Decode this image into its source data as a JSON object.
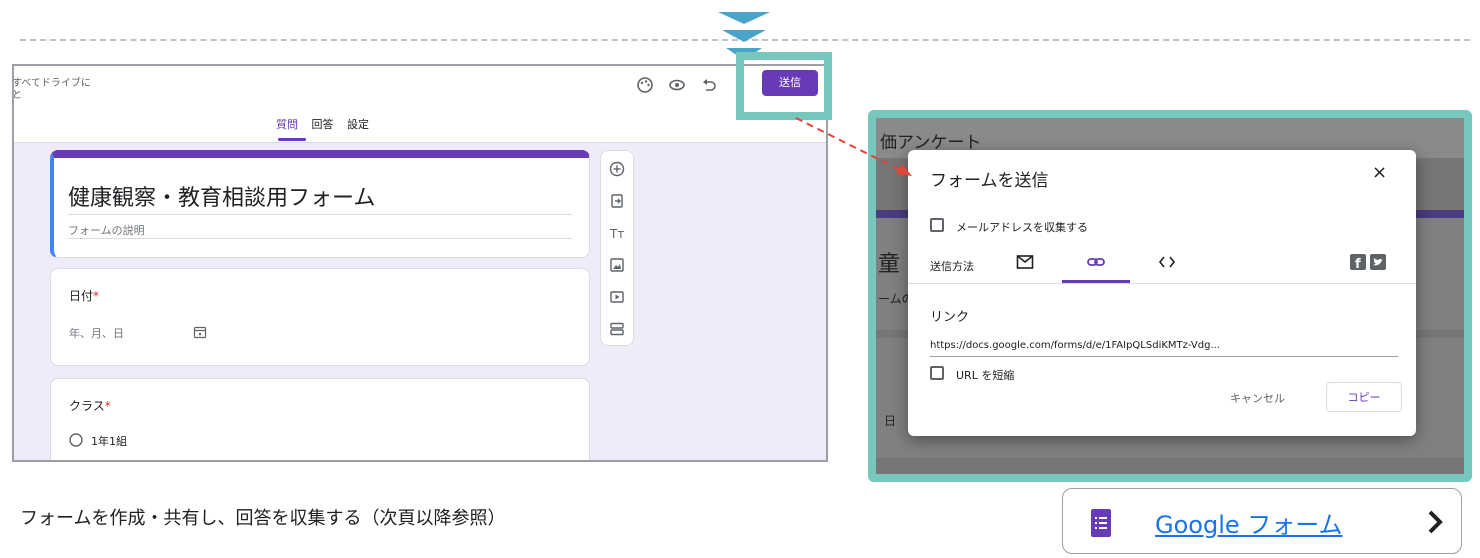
{
  "left_form": {
    "drive_notice": "すべてドライブに\nと",
    "tabs": [
      "質問",
      "回答",
      "設定"
    ],
    "send_label": "送信",
    "title": "健康観察・教育相談用フォーム",
    "description": "フォームの説明",
    "questions": [
      {
        "title": "日付",
        "required": "*",
        "placeholder": "年、月、日"
      },
      {
        "title": "クラス",
        "required": "*",
        "option": "1年1組"
      }
    ]
  },
  "right_dialog": {
    "bg_title": "価アンケート",
    "bg_big_char": "童",
    "bg_text2": "ームの",
    "bg_date": "日",
    "title": "フォームを送信",
    "close": "×",
    "collect_email": "メールアドレスを収集する",
    "send_method": "送信方法",
    "link_heading": "リンク",
    "url": "https://docs.google.com/forms/d/e/1FAIpQLSdiKMTz-Vdg...",
    "shorten_url": "URL を短縮",
    "cancel": "キャンセル",
    "copy": "コピー"
  },
  "caption": "フォームを作成・共有し、回答を収集する（次頁以降参照）",
  "google_forms_button": {
    "label": "Google フォーム"
  },
  "colors": {
    "accent": "#673ab7",
    "teal": "#76c8bc",
    "link": "#1a73e8"
  }
}
